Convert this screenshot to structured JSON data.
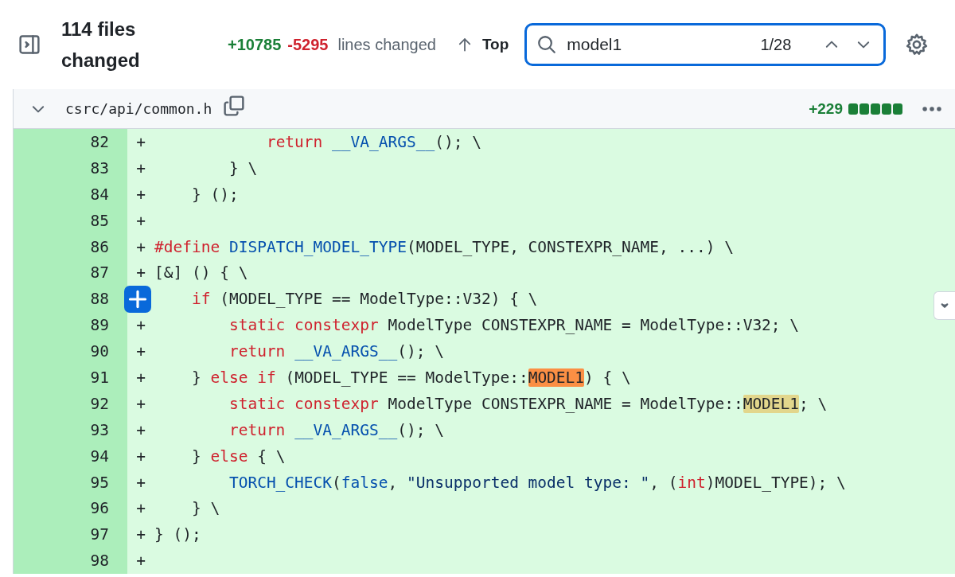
{
  "toolbar": {
    "title": "114 files changed",
    "additions": "+10785",
    "deletions": "-5295",
    "stats_label": "lines changed",
    "top_button": "Top",
    "search": {
      "value": "model1",
      "count": "1/28"
    }
  },
  "file": {
    "path": "csrc/api/common.h",
    "expanded": true,
    "additions": "+229",
    "diffstat": [
      {
        "color": "#1a7f37"
      },
      {
        "color": "#1a7f37"
      },
      {
        "color": "#1a7f37"
      },
      {
        "color": "#1a7f37"
      },
      {
        "color": "#1a7f37"
      }
    ],
    "lines": [
      {
        "number": "82",
        "marker": "+",
        "tokens": [
          {
            "kind": "keyword",
            "text": "            return"
          },
          {
            "kind": "macro",
            "text": " __VA_ARGS__"
          },
          {
            "kind": "plain",
            "text": "(); \\"
          }
        ]
      },
      {
        "number": "83",
        "marker": "+",
        "tokens": [
          {
            "kind": "plain",
            "text": "        } \\"
          }
        ]
      },
      {
        "number": "84",
        "marker": "+",
        "tokens": [
          {
            "kind": "plain",
            "text": "    } ();"
          }
        ]
      },
      {
        "number": "85",
        "marker": "+"
      },
      {
        "number": "86",
        "marker": "+",
        "tokens": [
          {
            "kind": "keyword",
            "text": "#define"
          },
          {
            "kind": "macro",
            "text": " DISPATCH_MODEL_TYPE"
          },
          {
            "kind": "plain",
            "text": "(MODEL_TYPE, CONSTEXPR_NAME, ...) \\"
          }
        ]
      },
      {
        "number": "87",
        "marker": "+",
        "tokens": [
          {
            "kind": "plain",
            "text": "[&] () { \\"
          }
        ]
      },
      {
        "number": "88",
        "hovered": true,
        "tokens": [
          {
            "kind": "keyword",
            "text": "    if"
          },
          {
            "kind": "plain",
            "text": " (MODEL_TYPE == ModelType::V32) { \\"
          }
        ]
      },
      {
        "number": "89",
        "marker": "+",
        "tokens": [
          {
            "kind": "keyword",
            "text": "        static constexpr"
          },
          {
            "kind": "plain",
            "text": " ModelType CONSTEXPR_NAME = ModelType::V32; \\"
          }
        ]
      },
      {
        "number": "90",
        "marker": "+",
        "tokens": [
          {
            "kind": "keyword",
            "text": "        return"
          },
          {
            "kind": "macro",
            "text": " __VA_ARGS__"
          },
          {
            "kind": "plain",
            "text": "(); \\"
          }
        ]
      },
      {
        "number": "91",
        "marker": "+",
        "tokens": [
          {
            "kind": "plain",
            "text": "    } "
          },
          {
            "kind": "keyword",
            "text": "else if"
          },
          {
            "kind": "plain",
            "text": " (MODEL_TYPE == ModelType::"
          },
          {
            "kind": "current_match",
            "text": "MODEL1"
          },
          {
            "kind": "plain",
            "text": ") { \\"
          }
        ]
      },
      {
        "number": "92",
        "marker": "+",
        "tokens": [
          {
            "kind": "keyword",
            "text": "        static constexpr"
          },
          {
            "kind": "plain",
            "text": " ModelType CONSTEXPR_NAME = ModelType::"
          },
          {
            "kind": "match",
            "text": "MODEL1"
          },
          {
            "kind": "plain",
            "text": "; \\"
          }
        ]
      },
      {
        "number": "93",
        "marker": "+",
        "tokens": [
          {
            "kind": "keyword",
            "text": "        return"
          },
          {
            "kind": "macro",
            "text": " __VA_ARGS__"
          },
          {
            "kind": "plain",
            "text": "(); \\"
          }
        ]
      },
      {
        "number": "94",
        "marker": "+",
        "tokens": [
          {
            "kind": "plain",
            "text": "    } "
          },
          {
            "kind": "keyword",
            "text": "else"
          },
          {
            "kind": "plain",
            "text": " { \\"
          }
        ]
      },
      {
        "number": "95",
        "marker": "+",
        "tokens": [
          {
            "kind": "macro",
            "text": "        TORCH_CHECK"
          },
          {
            "kind": "plain",
            "text": "("
          },
          {
            "kind": "macro",
            "text": "false"
          },
          {
            "kind": "plain",
            "text": ", "
          },
          {
            "kind": "string",
            "text": "\"Unsupported model type: \""
          },
          {
            "kind": "plain",
            "text": ", ("
          },
          {
            "kind": "keyword",
            "text": "int"
          },
          {
            "kind": "plain",
            "text": ")MODEL_TYPE); \\"
          }
        ]
      },
      {
        "number": "96",
        "marker": "+",
        "tokens": [
          {
            "kind": "plain",
            "text": "    } \\"
          }
        ]
      },
      {
        "number": "97",
        "marker": "+",
        "tokens": [
          {
            "kind": "plain",
            "text": "} ();"
          }
        ]
      },
      {
        "number": "98",
        "marker": "+"
      }
    ]
  }
}
